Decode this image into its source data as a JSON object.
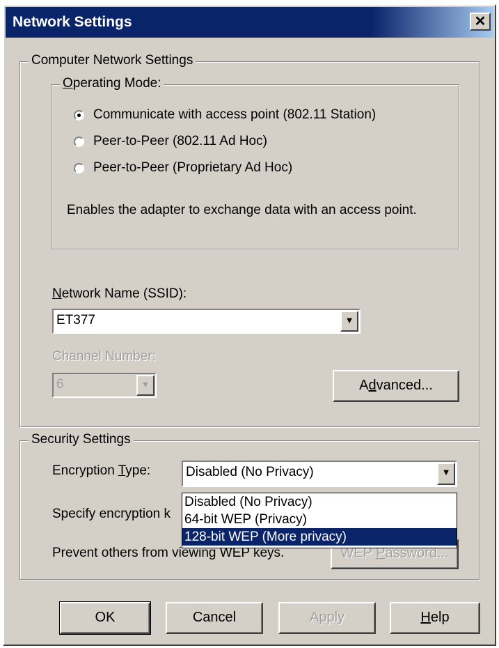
{
  "window": {
    "title": "Network Settings",
    "close_glyph": "✕"
  },
  "computer_group": {
    "legend": "Computer Network Settings",
    "operating_mode": {
      "legend": "Operating Mode:",
      "options": [
        {
          "label": "Communicate with access point (802.11 Station)",
          "selected": true
        },
        {
          "label": "Peer-to-Peer (802.11 Ad Hoc)",
          "selected": false
        },
        {
          "label": "Peer-to-Peer (Proprietary Ad Hoc)",
          "selected": false
        }
      ],
      "description": "Enables the adapter to exchange data with an access point."
    },
    "ssid": {
      "label": "Network Name (SSID):",
      "value": "ET377"
    },
    "channel": {
      "label": "Channel Number:",
      "value": "6"
    },
    "advanced_label": "Advanced..."
  },
  "security_group": {
    "legend": "Security Settings",
    "encryption_label": "Encryption Type:",
    "encryption_value": "Disabled (No Privacy)",
    "dropdown_options": [
      {
        "label": "Disabled (No Privacy)",
        "highlighted": false
      },
      {
        "label": "64-bit WEP (Privacy)",
        "highlighted": false
      },
      {
        "label": "128-bit WEP (More privacy)",
        "highlighted": true
      }
    ],
    "specify_key_label": "Specify encryption k",
    "prevent_label": "Prevent others from viewing WEP keys.",
    "wep_password_label": "WEP Password..."
  },
  "buttons": {
    "ok": "OK",
    "cancel": "Cancel",
    "apply": "Apply",
    "help": "Help"
  },
  "icons": {
    "close": "close-icon",
    "radio": "radio-button",
    "dropdown": "chevron-down-icon"
  },
  "colors": {
    "titlebar": "#0a246a",
    "face": "#d4d0c8",
    "highlight": "#0a246a"
  }
}
